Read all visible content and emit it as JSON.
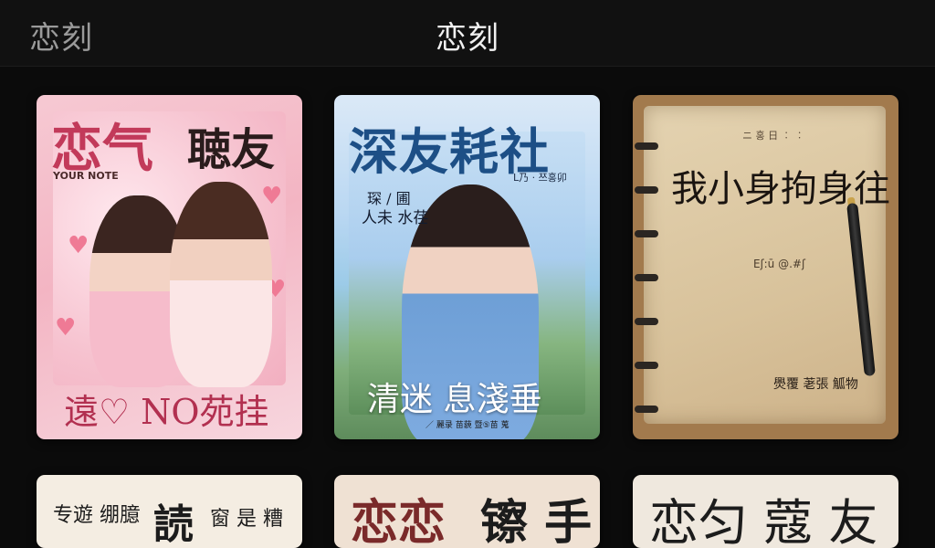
{
  "header": {
    "back_title": "恋刻",
    "title": "恋刻"
  },
  "cards": [
    {
      "title_a": "恋气",
      "title_b": "聴友",
      "subtitle": "YOUR NOTE",
      "bottom_text": "遠♡ NO苑挂"
    },
    {
      "title": "深友耗社",
      "tag": "L乃 · 쯔홍卯",
      "side_line_1": "琛 / 圃",
      "side_line_2": "人未 水荏",
      "bottom_text": "清迷  息淺垂",
      "caption": "／ 麗录 苗藐 暨⑤苗 蒐"
    },
    {
      "top_text": "ニ 홍 日 ︰ ︰",
      "title": "我小身拘身往",
      "scribble": "Eʃ:ū  @.#ʃ",
      "bottom_text": "爂覆 荖張 觚物"
    },
    {
      "text_1": "专遊 绷臆",
      "text_2": "読",
      "text_3": "窗 是 糟"
    },
    {
      "text_1": "恋恋",
      "text_2": "镲 手"
    },
    {
      "text_1": "恋匀 蔻 友"
    }
  ],
  "colors": {
    "background": "#0b0b0b",
    "topbar": "#111111",
    "title_text": "#f1f1f1",
    "back_text": "#9a9a9a"
  }
}
